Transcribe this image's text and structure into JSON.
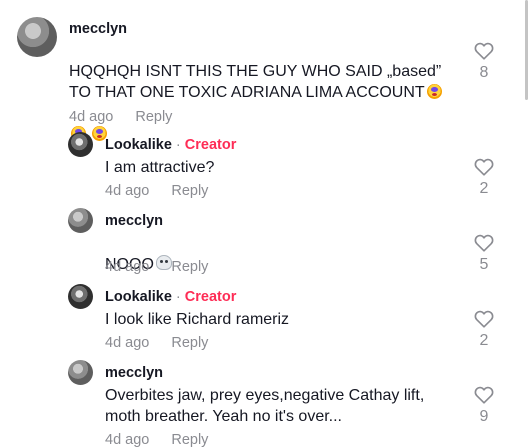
{
  "comments": [
    {
      "username": "mecclyn",
      "is_creator": false,
      "text": "HQQHQH ISNT THIS THE GUY WHO SAID „based” TO THAT ONE TOXIC ADRIANA LIMA ACCOUNT",
      "time": "4d ago",
      "reply_label": "Reply",
      "likes": "8"
    },
    {
      "username": "Lookalike",
      "separator": "·",
      "creator_badge": "Creator",
      "is_creator": true,
      "text": "I am attractive?",
      "time": "4d ago",
      "reply_label": "Reply",
      "likes": "2"
    },
    {
      "username": "mecclyn",
      "is_creator": false,
      "text": "NOOO",
      "time": "4d ago",
      "reply_label": "Reply",
      "likes": "5"
    },
    {
      "username": "Lookalike",
      "separator": "·",
      "creator_badge": "Creator",
      "is_creator": true,
      "text": "I look like Richard rameriz",
      "time": "4d ago",
      "reply_label": "Reply",
      "likes": "2"
    },
    {
      "username": "mecclyn",
      "is_creator": false,
      "text": "Overbites jaw, prey eyes,negative Cathay lift, moth breather. Yeah no it's over...",
      "time": "4d ago",
      "reply_label": "Reply",
      "likes": "9"
    }
  ],
  "icons": {
    "like": "heart-outline-icon",
    "avatar": "profile-photo"
  },
  "colors": {
    "creator": "#fe2c55",
    "meta": "#8a8b91",
    "text": "#161823"
  }
}
